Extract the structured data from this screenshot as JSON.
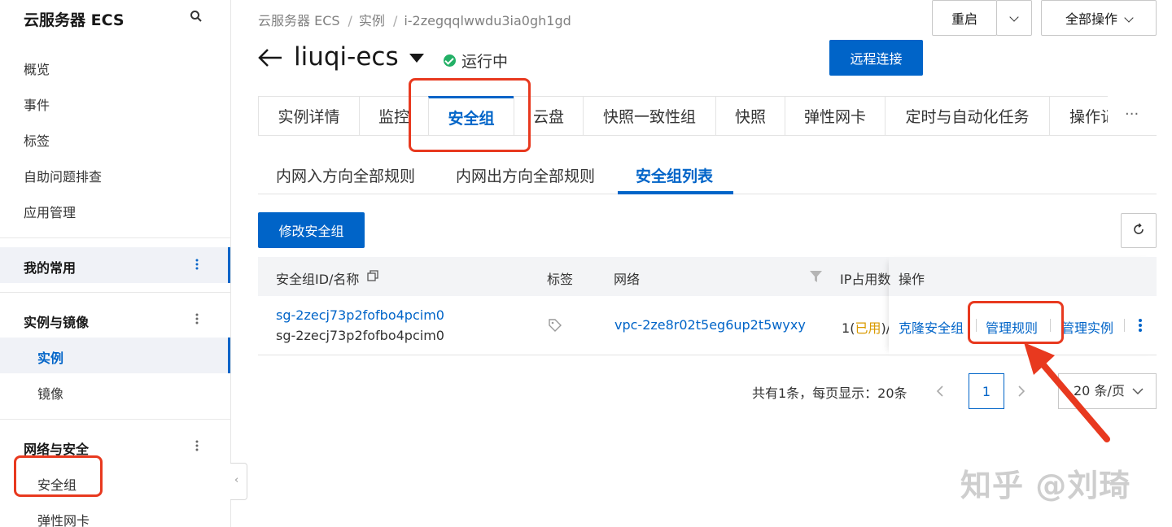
{
  "sidebar": {
    "title": "云服务器 ECS",
    "items": [
      "概览",
      "事件",
      "标签",
      "自助问题排查",
      "应用管理"
    ],
    "groups": {
      "favorites": "我的常用",
      "instances_images": "实例与镜像",
      "network_security": "网络与安全"
    },
    "sub_items": {
      "instance": "实例",
      "image": "镜像",
      "security_group": "安全组",
      "eni": "弹性网卡"
    }
  },
  "breadcrumb": [
    "云服务器 ECS",
    "实例",
    "i-2zegqqlwwdu3ia0gh1gd"
  ],
  "breadcrumb_sep": "/",
  "header": {
    "title": "liuqi-ecs",
    "status": "运行中",
    "remote_connect": "远程连接",
    "restart": "重启",
    "all_actions": "全部操作"
  },
  "tabs": [
    "实例详情",
    "监控",
    "安全组",
    "云盘",
    "快照一致性组",
    "快照",
    "弹性网卡",
    "定时与自动化任务",
    "操作记录"
  ],
  "tab_more": "···",
  "subtabs": [
    "内网入方向全部规则",
    "内网出方向全部规则",
    "安全组列表"
  ],
  "toolbar": {
    "modify": "修改安全组"
  },
  "table": {
    "headers": {
      "id_name": "安全组ID/名称",
      "tags": "标签",
      "network": "网络",
      "ip_usage": "IP占用数",
      "ops": "操作"
    },
    "row": {
      "id": "sg-2zecj73p2fofbo4pcim0",
      "name": "sg-2zecj73p2fofbo4pcim0",
      "network": "vpc-2ze8r02t5eg6up2t5wyxy",
      "ip_count": "1",
      "ip_used": "已用",
      "ip_paren_open": "(",
      "ip_paren_close": ")/",
      "op_clone": "克隆安全组",
      "op_manage_rules": "管理规则",
      "op_manage_instances": "管理实例"
    }
  },
  "pagination": {
    "summary": "共有1条，每页显示：20条",
    "current": "1",
    "page_size": "20 条/页"
  },
  "colors": {
    "primary": "#0064c8",
    "annotation": "#e8391f",
    "status_ok": "#23b066",
    "used": "#d99a00"
  },
  "watermark": "知乎 @刘琦"
}
